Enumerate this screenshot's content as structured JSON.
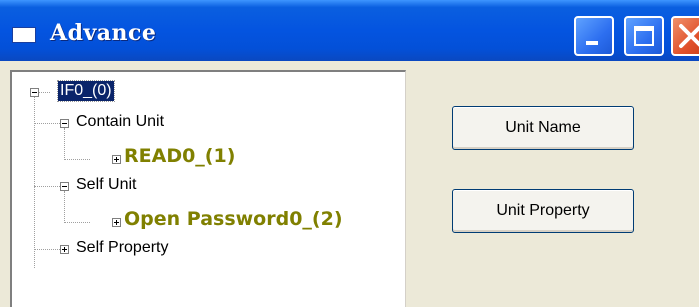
{
  "window": {
    "title": "Advance",
    "icon": "window-icon",
    "controls": {
      "minimize": "minimize-icon",
      "maximize": "maximize-icon",
      "close": "close-icon"
    }
  },
  "tree": {
    "nodes": [
      {
        "label": "IF0_(0)",
        "level": 0,
        "expander": "minus",
        "selected": true
      },
      {
        "label": "Contain Unit",
        "level": 1,
        "expander": "minus"
      },
      {
        "label": "READ0_(1)",
        "level": 2,
        "expander": "plus",
        "highlight": true
      },
      {
        "label": "Self Unit",
        "level": 1,
        "expander": "minus"
      },
      {
        "label": "Open Password0_(2)",
        "level": 2,
        "expander": "plus",
        "highlight": true
      },
      {
        "label": "Self Property",
        "level": 1,
        "expander": "plus"
      }
    ],
    "highlight_color": "#808000",
    "selection_color": "#0a246a"
  },
  "buttons": {
    "unit_name": "Unit Name",
    "unit_property": "Unit Property"
  },
  "colors": {
    "titlebar": "#0454e0",
    "dialog_bg": "#ece9d8",
    "close_button": "#e0502a"
  }
}
